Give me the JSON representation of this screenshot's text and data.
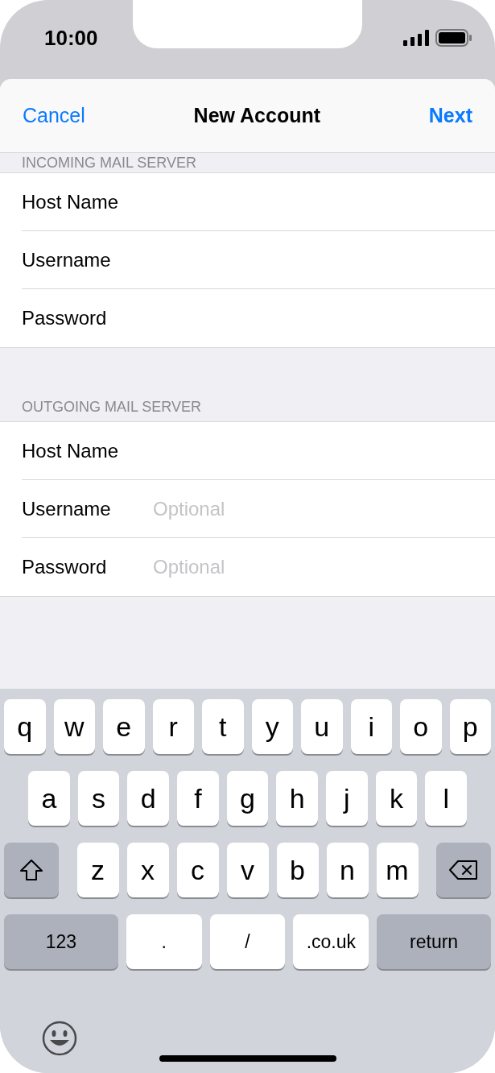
{
  "status_bar": {
    "time": "10:00"
  },
  "nav": {
    "cancel": "Cancel",
    "title": "New Account",
    "next": "Next"
  },
  "sections": [
    {
      "header": "INCOMING MAIL SERVER",
      "fields": [
        {
          "label": "Host Name"
        },
        {
          "label": "Username"
        },
        {
          "label": "Password"
        }
      ]
    },
    {
      "header": "OUTGOING MAIL SERVER",
      "fields": [
        {
          "label": "Host Name"
        },
        {
          "label": "Username",
          "placeholder": "Optional"
        },
        {
          "label": "Password",
          "placeholder": "Optional"
        }
      ]
    }
  ],
  "keyboard": {
    "rows": [
      {
        "keys": [
          {
            "kind": "char",
            "label": "q"
          },
          {
            "kind": "char",
            "label": "w"
          },
          {
            "kind": "char",
            "label": "e"
          },
          {
            "kind": "char",
            "label": "r"
          },
          {
            "kind": "char",
            "label": "t"
          },
          {
            "kind": "char",
            "label": "y"
          },
          {
            "kind": "char",
            "label": "u"
          },
          {
            "kind": "char",
            "label": "i"
          },
          {
            "kind": "char",
            "label": "o"
          },
          {
            "kind": "char",
            "label": "p"
          }
        ]
      },
      {
        "keys": [
          {
            "kind": "char",
            "label": "a"
          },
          {
            "kind": "char",
            "label": "s"
          },
          {
            "kind": "char",
            "label": "d"
          },
          {
            "kind": "char",
            "label": "f"
          },
          {
            "kind": "char",
            "label": "g"
          },
          {
            "kind": "char",
            "label": "h"
          },
          {
            "kind": "char",
            "label": "j"
          },
          {
            "kind": "char",
            "label": "k"
          },
          {
            "kind": "char",
            "label": "l"
          }
        ]
      },
      {
        "keys": [
          {
            "kind": "shift"
          },
          {
            "kind": "char",
            "label": "z"
          },
          {
            "kind": "char",
            "label": "x"
          },
          {
            "kind": "char",
            "label": "c"
          },
          {
            "kind": "char",
            "label": "v"
          },
          {
            "kind": "char",
            "label": "b"
          },
          {
            "kind": "char",
            "label": "n"
          },
          {
            "kind": "char",
            "label": "m"
          },
          {
            "kind": "delete"
          }
        ]
      },
      {
        "keys": [
          {
            "kind": "mode",
            "label": "123"
          },
          {
            "kind": "char",
            "label": "."
          },
          {
            "kind": "char",
            "label": "/"
          },
          {
            "kind": "char",
            "label": ".co.uk"
          },
          {
            "kind": "mode",
            "label": "return"
          }
        ]
      }
    ]
  }
}
